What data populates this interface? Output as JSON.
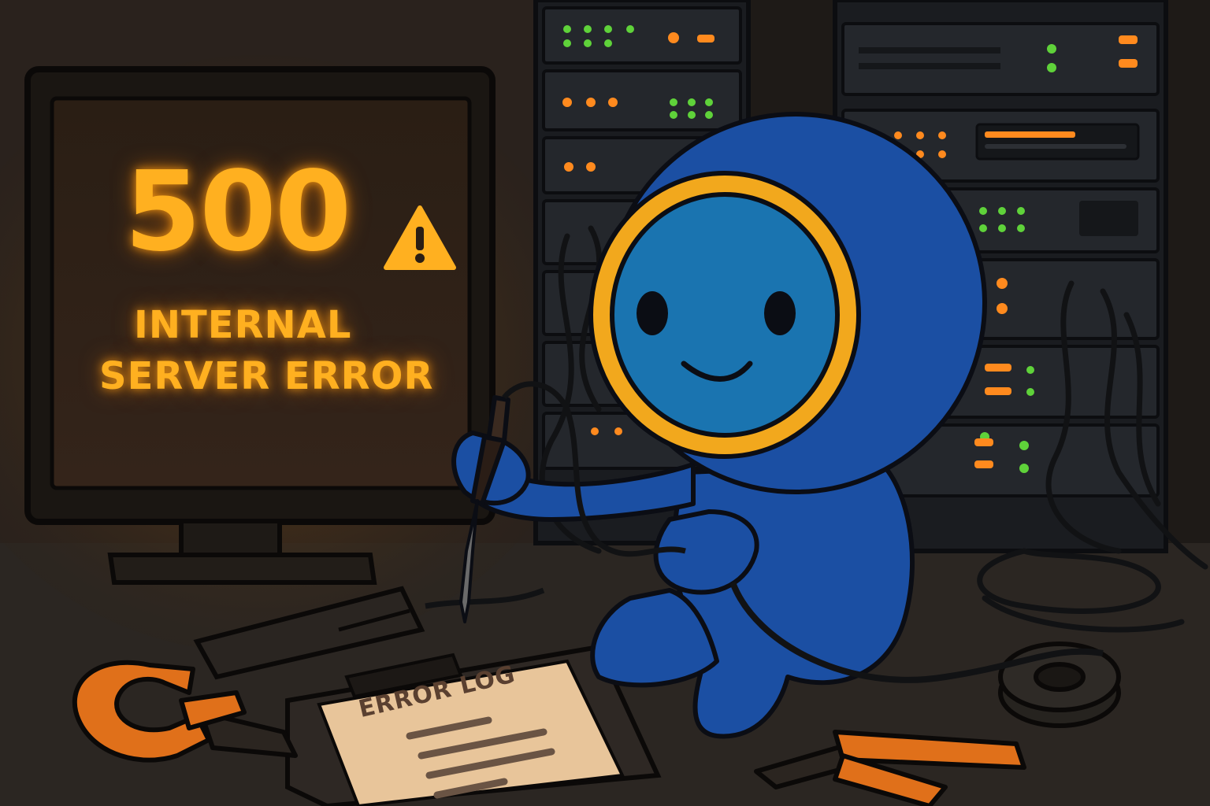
{
  "monitor": {
    "code": "500",
    "line1": "INTERNAL",
    "line2": "SERVER ERROR",
    "warning_icon": "warning-triangle-icon"
  },
  "clipboard": {
    "title": "ERROR LOG"
  },
  "colors": {
    "screen_glow": "#ffb020",
    "mascot_body": "#1b4fa3",
    "mascot_ring": "#f2a81d",
    "led_orange": "#ff8a1e",
    "led_green": "#5fd23a",
    "tool_orange": "#e0701a"
  }
}
